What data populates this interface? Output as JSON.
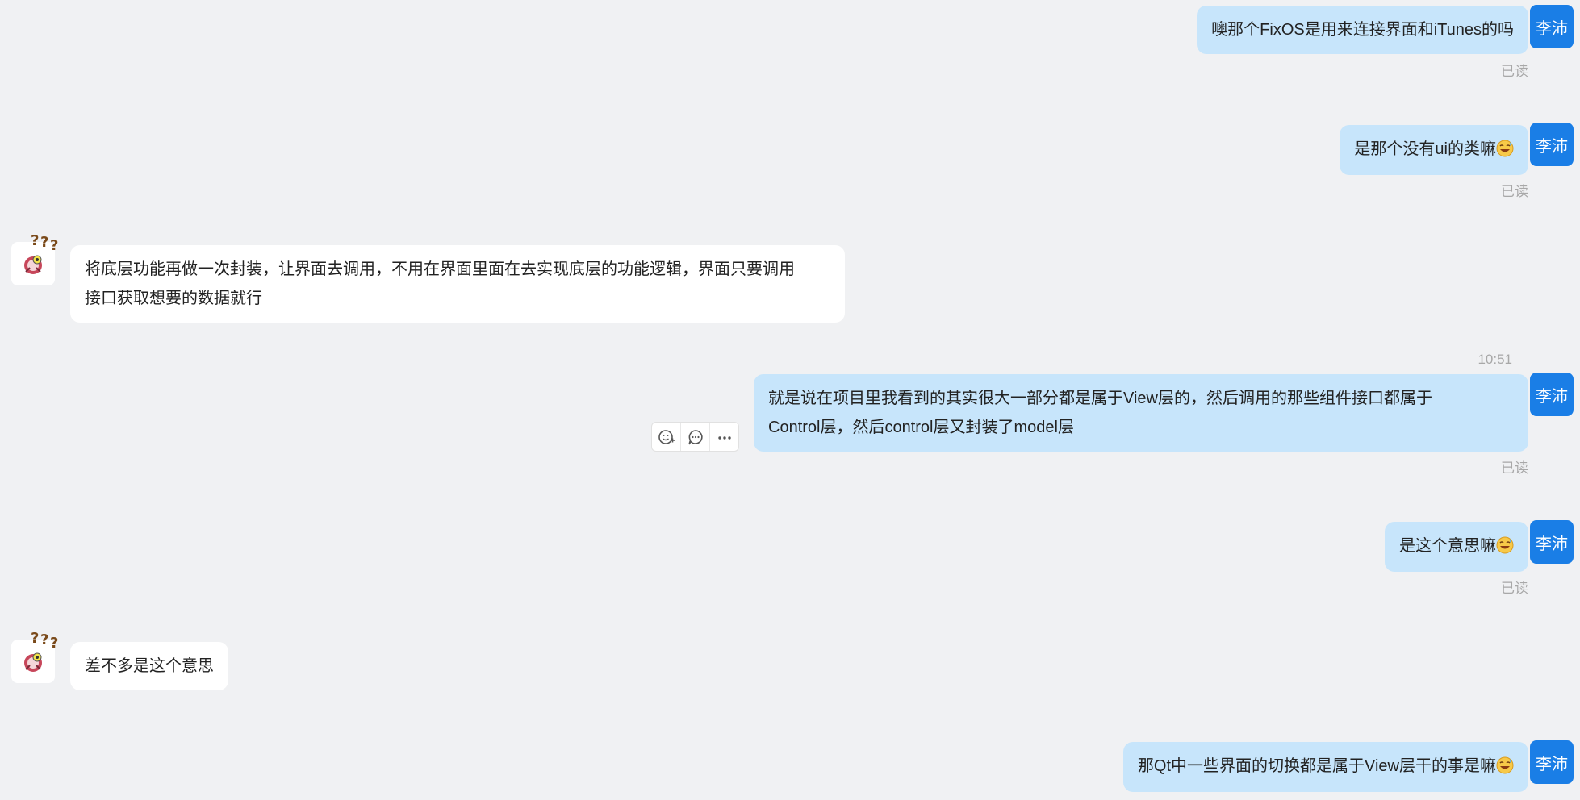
{
  "user_name": "李沛",
  "messages": [
    {
      "id": "m1",
      "side": "me",
      "text": "噢那个FixOS是用来连接界面和iTunes的吗",
      "status": "已读"
    },
    {
      "id": "m2",
      "side": "me",
      "text": "是那个没有ui的类嘛",
      "emoji": "grin-sweat",
      "status": "已读"
    },
    {
      "id": "m3",
      "side": "other",
      "line1": "将底层功能再做一次封装，让界面去调用，不用在界面里面在去实现底层的功能逻辑，界面只要调用",
      "line2": "接口获取想要的数据就行"
    },
    {
      "id": "m4",
      "side": "me",
      "time": "10:51",
      "line1": "就是说在项目里我看到的其实很大一部分都是属于View层的，然后调用的那些组件接口都属于",
      "line2": "Control层，然后control层又封装了model层",
      "status": "已读"
    },
    {
      "id": "m5",
      "side": "me",
      "text": "是这个意思嘛",
      "emoji": "grin-sweat",
      "status": "已读"
    },
    {
      "id": "m6",
      "side": "other",
      "text": "差不多是这个意思"
    },
    {
      "id": "m7",
      "side": "me",
      "text": "那Qt中一些界面的切换都是属于View层干的事是嘛",
      "emoji": "grin-sweat"
    }
  ],
  "message_tools": [
    "emoji-reaction-icon",
    "reply-comment-icon",
    "more-options-icon"
  ],
  "colors": {
    "background": "#f0f1f3",
    "my_bubble": "#c7e5fb",
    "other_bubble": "#ffffff",
    "avatar": "#1a7ee6",
    "status_text": "#a8a8a8"
  }
}
